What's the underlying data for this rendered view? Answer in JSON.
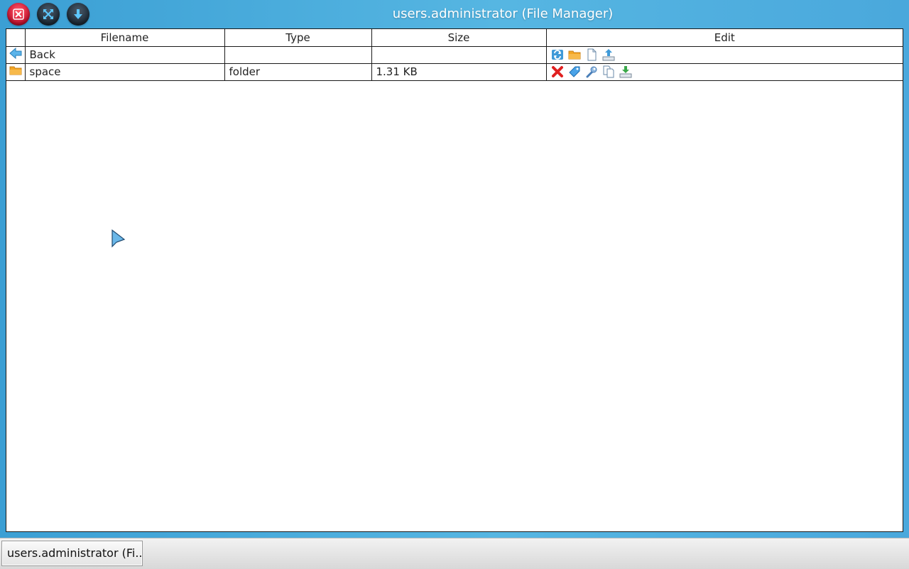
{
  "window": {
    "title": "users.administrator (File Manager)",
    "buttons": [
      "close",
      "maximize",
      "minimize"
    ]
  },
  "table": {
    "columns": [
      "Filename",
      "Type",
      "Size",
      "Edit"
    ],
    "rows": [
      {
        "icon": "back-arrow-icon",
        "name": "Back",
        "type": "",
        "size": "",
        "edit_icons": [
          "refresh-icon",
          "new-folder-icon",
          "new-file-icon",
          "upload-icon"
        ]
      },
      {
        "icon": "folder-icon",
        "name": "space",
        "type": "folder",
        "size": "1.31 KB",
        "edit_icons": [
          "delete-icon",
          "rename-icon",
          "properties-icon",
          "copy-icon",
          "download-icon"
        ]
      }
    ]
  },
  "taskbar": {
    "task_label": "users.administrator (Fi..."
  },
  "colors": {
    "desktop": "#4aa8dc",
    "close_button": "#c8102e",
    "window_button": "#1d2a36",
    "folder": "#f4a623"
  }
}
